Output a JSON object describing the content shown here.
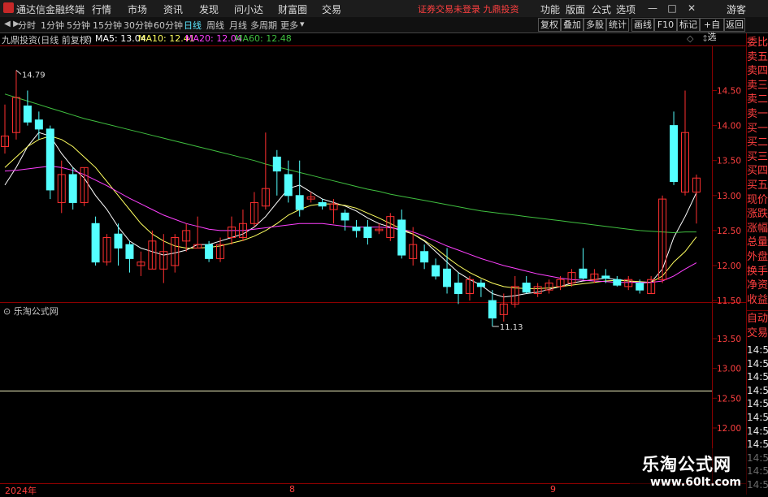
{
  "titlebar": {
    "app_title": "通达信金融终端",
    "menus": [
      "行情",
      "市场",
      "资讯",
      "发现",
      "问小达",
      "财富圈",
      "交易"
    ],
    "notice": "证券交易未登录  九鼎投资",
    "right_menus": [
      "功能",
      "版面",
      "公式",
      "选项"
    ],
    "guest": "游客"
  },
  "toolbar": {
    "periods": [
      "分时",
      "1分钟",
      "5分钟",
      "15分钟",
      "30分钟",
      "60分钟",
      "日线",
      "周线",
      "月线",
      "多周期",
      "更多"
    ],
    "active_period": "日线",
    "buttons": [
      "复权",
      "叠加",
      "多股",
      "统计",
      "画线",
      "F10",
      "标记",
      "+自选",
      "返回"
    ]
  },
  "chart_header": {
    "stock": "九鼎投资(日线 前复权)",
    "ma5": "MA5: 13.04",
    "ma10": "MA10: 12.41",
    "ma20": "MA20: 12.04",
    "ma60": "MA60: 12.48"
  },
  "colors": {
    "up": "#ff3030",
    "down": "#54ffff",
    "ma5": "#ffffff",
    "ma10": "#ffff60",
    "ma20": "#ff40ff",
    "ma60": "#40c040",
    "frame": "#8b0000",
    "axis_text": "#ff4040"
  },
  "main_axis": {
    "ticks": [
      "14.50",
      "14.00",
      "13.50",
      "13.00",
      "12.50",
      "12.00",
      "11.50"
    ]
  },
  "sub_panel": {
    "title": "乐淘公式网",
    "ticks": [
      "13.50",
      "13.00",
      "12.50",
      "12.00"
    ]
  },
  "annotations": {
    "high": "14.79",
    "low": "11.13"
  },
  "dates": [
    "2024年",
    "8",
    "9"
  ],
  "right_panel": {
    "labels_top": [
      "委比",
      "卖五",
      "卖四",
      "卖三",
      "卖二",
      "卖一",
      "买一",
      "买二",
      "买三",
      "买四",
      "买五",
      "现价",
      "涨跌",
      "涨幅",
      "总量",
      "外盘",
      "换手",
      "净资",
      "收益"
    ],
    "labels_bottom": [
      "自动",
      "交易"
    ],
    "times": [
      "14:55",
      "14:56",
      "14:56",
      "14:56",
      "14:56",
      "14:56",
      "14:56",
      "14:56",
      "14:56",
      "14:56",
      "14:56"
    ]
  },
  "watermark": {
    "title": "乐淘公式网",
    "url": "www.60lt.com"
  },
  "chart_data": {
    "type": "candlestick",
    "ylim": [
      11.0,
      14.9
    ],
    "candles": [
      {
        "o": 13.7,
        "h": 14.3,
        "l": 13.6,
        "c": 13.85
      },
      {
        "o": 13.9,
        "h": 14.79,
        "l": 13.8,
        "c": 14.4
      },
      {
        "o": 14.28,
        "h": 14.5,
        "l": 14.0,
        "c": 14.05
      },
      {
        "o": 14.08,
        "h": 14.2,
        "l": 13.8,
        "c": 13.95
      },
      {
        "o": 13.95,
        "h": 14.0,
        "l": 12.95,
        "c": 13.08
      },
      {
        "o": 12.9,
        "h": 13.5,
        "l": 12.75,
        "c": 13.3
      },
      {
        "o": 13.3,
        "h": 13.4,
        "l": 12.8,
        "c": 12.9
      },
      {
        "o": 12.9,
        "h": 13.4,
        "l": 12.85,
        "c": 13.4
      },
      {
        "o": 12.6,
        "h": 12.7,
        "l": 12.0,
        "c": 12.05
      },
      {
        "o": 12.05,
        "h": 12.45,
        "l": 12.0,
        "c": 12.4
      },
      {
        "o": 12.45,
        "h": 12.6,
        "l": 12.0,
        "c": 12.25
      },
      {
        "o": 12.3,
        "h": 12.35,
        "l": 11.9,
        "c": 12.1
      },
      {
        "o": 12.0,
        "h": 12.2,
        "l": 11.85,
        "c": 12.05
      },
      {
        "o": 11.95,
        "h": 12.5,
        "l": 11.95,
        "c": 12.35
      },
      {
        "o": 11.95,
        "h": 12.45,
        "l": 11.75,
        "c": 12.2
      },
      {
        "o": 12.0,
        "h": 12.45,
        "l": 11.9,
        "c": 12.4
      },
      {
        "o": 12.35,
        "h": 12.6,
        "l": 12.2,
        "c": 12.5
      },
      {
        "o": 12.25,
        "h": 12.7,
        "l": 12.25,
        "c": 12.3
      },
      {
        "o": 12.3,
        "h": 12.35,
        "l": 12.05,
        "c": 12.1
      },
      {
        "o": 12.1,
        "h": 12.4,
        "l": 12.05,
        "c": 12.3
      },
      {
        "o": 12.4,
        "h": 12.7,
        "l": 12.3,
        "c": 12.55
      },
      {
        "o": 12.4,
        "h": 12.8,
        "l": 12.35,
        "c": 12.6
      },
      {
        "o": 12.6,
        "h": 13.05,
        "l": 12.55,
        "c": 12.9
      },
      {
        "o": 12.85,
        "h": 13.9,
        "l": 12.8,
        "c": 13.1
      },
      {
        "o": 13.55,
        "h": 13.65,
        "l": 13.0,
        "c": 13.35
      },
      {
        "o": 13.3,
        "h": 13.5,
        "l": 12.9,
        "c": 13.0
      },
      {
        "o": 13.0,
        "h": 13.5,
        "l": 12.7,
        "c": 12.8
      },
      {
        "o": 12.95,
        "h": 13.05,
        "l": 12.9,
        "c": 12.98
      },
      {
        "o": 12.9,
        "h": 12.95,
        "l": 12.8,
        "c": 12.85
      },
      {
        "o": 12.8,
        "h": 12.95,
        "l": 12.6,
        "c": 12.88
      },
      {
        "o": 12.75,
        "h": 12.8,
        "l": 12.5,
        "c": 12.65
      },
      {
        "o": 12.55,
        "h": 12.65,
        "l": 12.4,
        "c": 12.5
      },
      {
        "o": 12.55,
        "h": 12.65,
        "l": 12.3,
        "c": 12.4
      },
      {
        "o": 12.5,
        "h": 12.6,
        "l": 12.45,
        "c": 12.52
      },
      {
        "o": 12.4,
        "h": 12.75,
        "l": 12.35,
        "c": 12.7
      },
      {
        "o": 12.65,
        "h": 12.8,
        "l": 12.1,
        "c": 12.15
      },
      {
        "o": 12.1,
        "h": 12.55,
        "l": 12.0,
        "c": 12.3
      },
      {
        "o": 12.2,
        "h": 12.3,
        "l": 11.95,
        "c": 12.05
      },
      {
        "o": 12.0,
        "h": 12.1,
        "l": 11.8,
        "c": 11.85
      },
      {
        "o": 11.95,
        "h": 12.25,
        "l": 11.6,
        "c": 11.7
      },
      {
        "o": 11.75,
        "h": 11.9,
        "l": 11.45,
        "c": 11.6
      },
      {
        "o": 11.6,
        "h": 11.85,
        "l": 11.5,
        "c": 11.8
      },
      {
        "o": 11.75,
        "h": 11.8,
        "l": 11.55,
        "c": 11.7
      },
      {
        "o": 11.5,
        "h": 11.65,
        "l": 11.13,
        "c": 11.25
      },
      {
        "o": 11.3,
        "h": 11.6,
        "l": 11.2,
        "c": 11.45
      },
      {
        "o": 11.45,
        "h": 11.85,
        "l": 11.4,
        "c": 11.7
      },
      {
        "o": 11.75,
        "h": 11.85,
        "l": 11.6,
        "c": 11.62
      },
      {
        "o": 11.6,
        "h": 11.75,
        "l": 11.55,
        "c": 11.7
      },
      {
        "o": 11.65,
        "h": 11.8,
        "l": 11.6,
        "c": 11.75
      },
      {
        "o": 11.7,
        "h": 11.85,
        "l": 11.65,
        "c": 11.8
      },
      {
        "o": 11.75,
        "h": 11.95,
        "l": 11.7,
        "c": 11.9
      },
      {
        "o": 11.95,
        "h": 12.25,
        "l": 11.8,
        "c": 11.82
      },
      {
        "o": 11.8,
        "h": 11.95,
        "l": 11.75,
        "c": 11.88
      },
      {
        "o": 11.85,
        "h": 11.95,
        "l": 11.75,
        "c": 11.82
      },
      {
        "o": 11.8,
        "h": 11.85,
        "l": 11.7,
        "c": 11.72
      },
      {
        "o": 11.7,
        "h": 11.85,
        "l": 11.65,
        "c": 11.8
      },
      {
        "o": 11.75,
        "h": 11.8,
        "l": 11.6,
        "c": 11.65
      },
      {
        "o": 11.6,
        "h": 11.85,
        "l": 11.6,
        "c": 11.8
      },
      {
        "o": 11.8,
        "h": 13.0,
        "l": 11.75,
        "c": 12.95
      },
      {
        "o": 14.0,
        "h": 14.2,
        "l": 13.15,
        "c": 13.2
      },
      {
        "o": 13.05,
        "h": 14.5,
        "l": 13.0,
        "c": 13.9
      },
      {
        "o": 13.05,
        "h": 13.3,
        "l": 12.6,
        "c": 13.25
      }
    ],
    "ma_series": [
      {
        "name": "MA5",
        "values": [
          13.15,
          13.4,
          13.7,
          13.9,
          13.85,
          13.6,
          13.4,
          13.25,
          13.0,
          12.8,
          12.55,
          12.35,
          12.25,
          12.2,
          12.15,
          12.18,
          12.22,
          12.3,
          12.3,
          12.35,
          12.4,
          12.45,
          12.55,
          12.7,
          12.9,
          13.1,
          13.15,
          13.05,
          12.95,
          12.9,
          12.85,
          12.78,
          12.68,
          12.6,
          12.55,
          12.5,
          12.45,
          12.35,
          12.2,
          12.05,
          11.9,
          11.8,
          11.72,
          11.6,
          11.55,
          11.57,
          11.6,
          11.62,
          11.66,
          11.7,
          11.75,
          11.78,
          11.8,
          11.82,
          11.8,
          11.78,
          11.75,
          11.76,
          11.95,
          12.4,
          12.7,
          13.04
        ]
      },
      {
        "name": "MA10",
        "values": [
          13.4,
          13.55,
          13.7,
          13.8,
          13.85,
          13.8,
          13.7,
          13.55,
          13.4,
          13.2,
          13.0,
          12.8,
          12.6,
          12.45,
          12.35,
          12.28,
          12.25,
          12.25,
          12.26,
          12.28,
          12.32,
          12.36,
          12.42,
          12.5,
          12.6,
          12.72,
          12.8,
          12.86,
          12.88,
          12.88,
          12.86,
          12.82,
          12.75,
          12.68,
          12.6,
          12.52,
          12.45,
          12.36,
          12.25,
          12.12,
          12.0,
          11.9,
          11.82,
          11.75,
          11.7,
          11.68,
          11.67,
          11.67,
          11.68,
          11.7,
          11.72,
          11.74,
          11.76,
          11.78,
          11.79,
          11.78,
          11.77,
          11.76,
          11.85,
          12.05,
          12.2,
          12.41
        ]
      },
      {
        "name": "MA20",
        "values": [
          13.35,
          13.36,
          13.38,
          13.4,
          13.42,
          13.4,
          13.36,
          13.3,
          13.22,
          13.14,
          13.05,
          12.96,
          12.88,
          12.8,
          12.72,
          12.66,
          12.6,
          12.56,
          12.52,
          12.5,
          12.5,
          12.5,
          12.52,
          12.54,
          12.56,
          12.58,
          12.6,
          12.6,
          12.6,
          12.58,
          12.56,
          12.55,
          12.55,
          12.55,
          12.54,
          12.52,
          12.48,
          12.42,
          12.35,
          12.28,
          12.22,
          12.16,
          12.1,
          12.05,
          12.0,
          11.96,
          11.92,
          11.88,
          11.85,
          11.82,
          11.8,
          11.79,
          11.78,
          11.77,
          11.76,
          11.76,
          11.76,
          11.76,
          11.78,
          11.85,
          11.95,
          12.04
        ]
      },
      {
        "name": "MA60",
        "values": [
          14.45,
          14.4,
          14.35,
          14.3,
          14.25,
          14.2,
          14.15,
          14.1,
          14.06,
          14.02,
          13.98,
          13.94,
          13.9,
          13.86,
          13.82,
          13.78,
          13.74,
          13.7,
          13.66,
          13.62,
          13.58,
          13.54,
          13.5,
          13.45,
          13.41,
          13.37,
          13.33,
          13.29,
          13.25,
          13.21,
          13.17,
          13.13,
          13.09,
          13.06,
          13.02,
          12.99,
          12.96,
          12.93,
          12.9,
          12.87,
          12.84,
          12.81,
          12.78,
          12.76,
          12.74,
          12.72,
          12.7,
          12.68,
          12.66,
          12.64,
          12.62,
          12.6,
          12.58,
          12.56,
          12.54,
          12.52,
          12.5,
          12.49,
          12.48,
          12.47,
          12.48,
          12.48
        ]
      }
    ],
    "sub_line": {
      "value": 12.62
    }
  }
}
